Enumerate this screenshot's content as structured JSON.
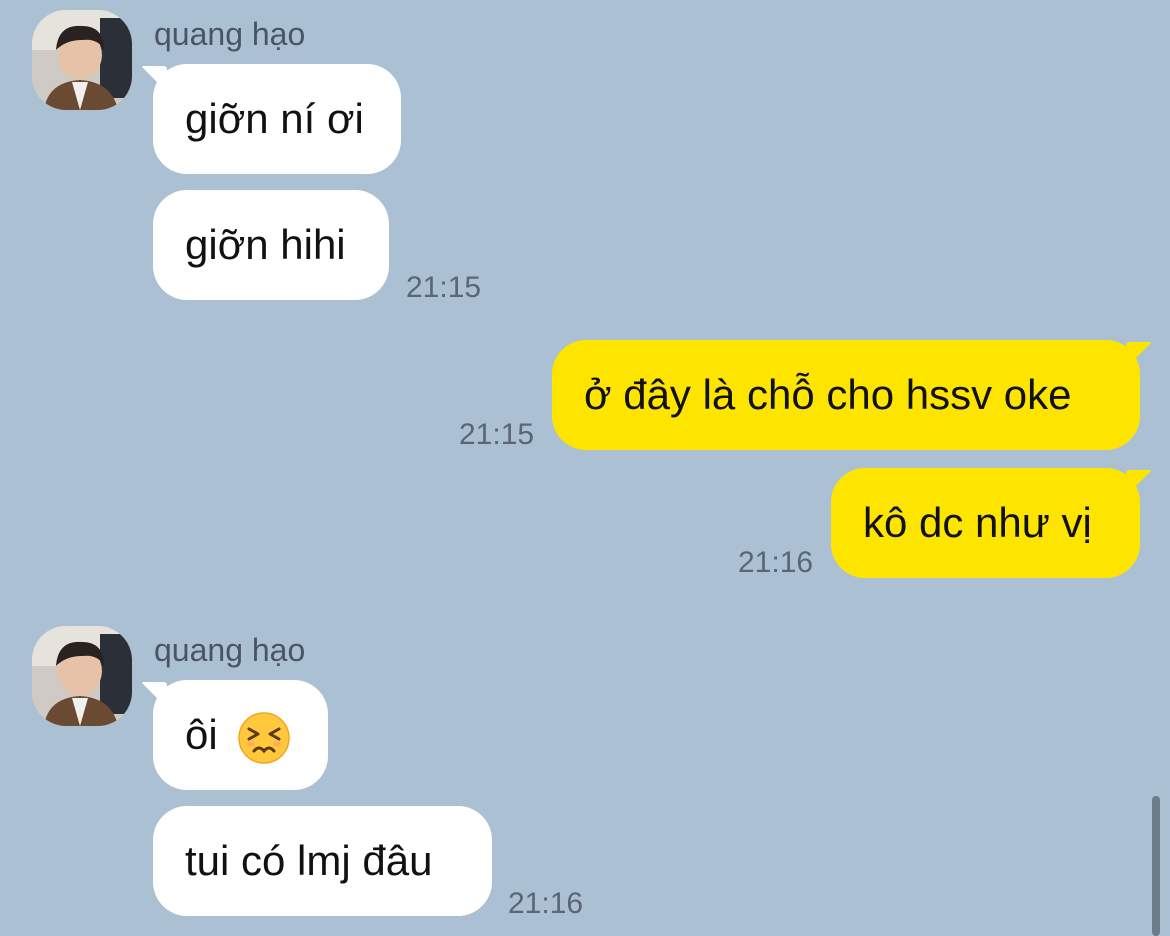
{
  "messages": [
    {
      "sender": "quang hạo",
      "bubbles": [
        "giỡn ní ơi",
        "giỡn hihi"
      ],
      "time": "21:15"
    },
    {
      "text": "ở đây là chỗ cho hssv oke",
      "time": "21:15"
    },
    {
      "text": "kô dc như vị",
      "time": "21:16"
    },
    {
      "sender": "quang hạo",
      "bubbles": [
        "ôi",
        "tui có lmj đâu"
      ],
      "emoji": "persevering-face-emoji",
      "time": "21:16"
    }
  ],
  "colors": {
    "background": "#abc1d3",
    "incoming_bubble": "#ffffff",
    "outgoing_bubble": "#fee500"
  }
}
